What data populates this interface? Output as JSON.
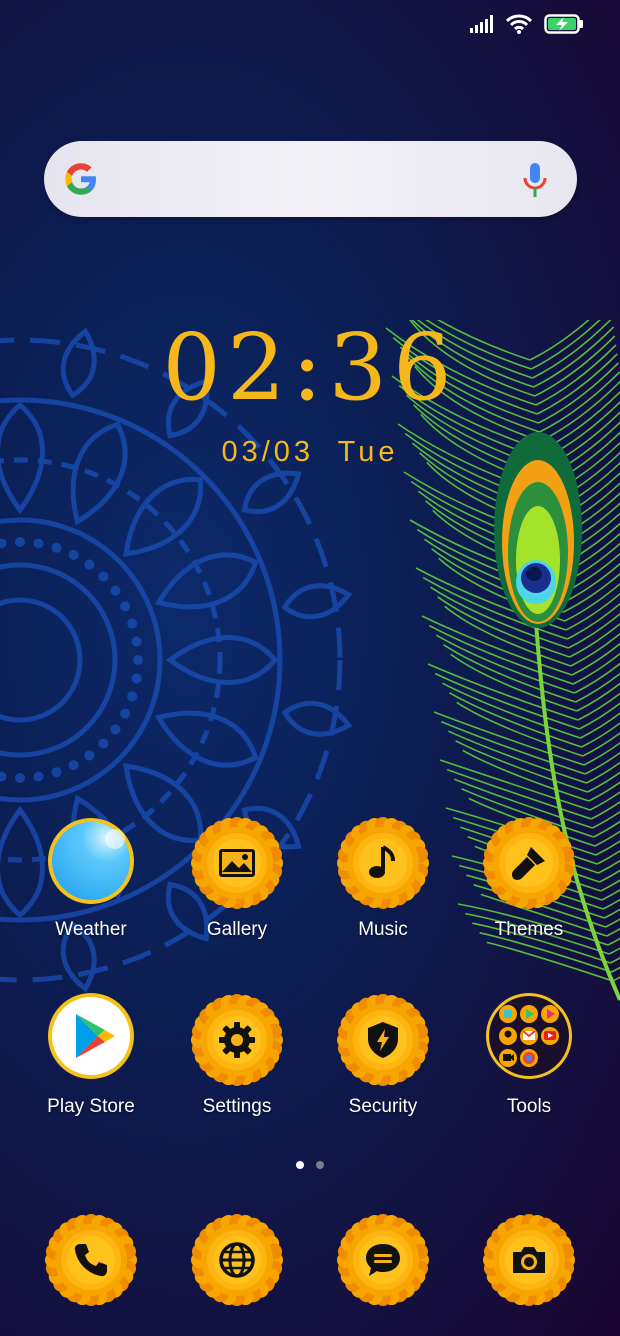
{
  "status_bar": {
    "signal_icon": "cell-signal-icon",
    "wifi_icon": "wifi-icon",
    "battery_icon": "battery-charging-icon"
  },
  "search": {
    "logo": "google-g-icon",
    "voice_icon": "microphone-icon"
  },
  "clock": {
    "time": "02:36",
    "date": "03/03  Tue"
  },
  "apps": [
    {
      "label": "Weather",
      "icon": "weather-icon"
    },
    {
      "label": "Gallery",
      "icon": "gallery-icon"
    },
    {
      "label": "Music",
      "icon": "music-note-icon"
    },
    {
      "label": "Themes",
      "icon": "paintbrush-icon"
    },
    {
      "label": "Play Store",
      "icon": "play-store-icon"
    },
    {
      "label": "Settings",
      "icon": "gear-icon"
    },
    {
      "label": "Security",
      "icon": "shield-bolt-icon"
    },
    {
      "label": "Tools",
      "icon": "folder-icon"
    }
  ],
  "page_indicator": {
    "pages": 2,
    "current": 1
  },
  "dock": [
    {
      "icon": "phone-icon"
    },
    {
      "icon": "globe-icon"
    },
    {
      "icon": "message-icon"
    },
    {
      "icon": "camera-icon"
    }
  ],
  "colors": {
    "accent": "#f6b71a",
    "flower_petal": "#f7a600",
    "flower_center": "#ffc21c",
    "background_top": "#1a0530",
    "background_mid": "#0b1f55",
    "label_text": "#ffffff"
  }
}
